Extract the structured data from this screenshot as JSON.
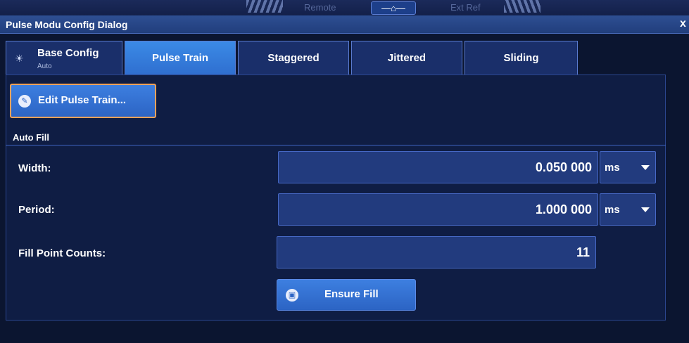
{
  "status_bar": {
    "remote_label": "Remote",
    "ext_ref_label": "Ext Ref",
    "home_icon": "home-icon"
  },
  "dialog": {
    "title": "Pulse Modu Config Dialog",
    "close_glyph": "x"
  },
  "tabs": [
    {
      "label": "Base Config",
      "sublabel": "Auto",
      "icon": "sun-icon",
      "active": false
    },
    {
      "label": "Pulse Train",
      "active": true
    },
    {
      "label": "Staggered",
      "active": false
    },
    {
      "label": "Jittered",
      "active": false
    },
    {
      "label": "Sliding",
      "active": false
    }
  ],
  "edit_button": {
    "label": "Edit Pulse Train..."
  },
  "auto_fill": {
    "section_title": "Auto Fill",
    "width": {
      "label": "Width:",
      "value": "0.050 000",
      "unit": "ms"
    },
    "period": {
      "label": "Period:",
      "value": "1.000 000",
      "unit": "ms"
    },
    "fill_point_counts": {
      "label": "Fill Point Counts:",
      "value": "11"
    },
    "ensure_button": {
      "label": "Ensure Fill"
    }
  },
  "colors": {
    "background": "#0b1530",
    "active_tab": "#3b8ae6",
    "focus_border": "#f3a25a"
  }
}
